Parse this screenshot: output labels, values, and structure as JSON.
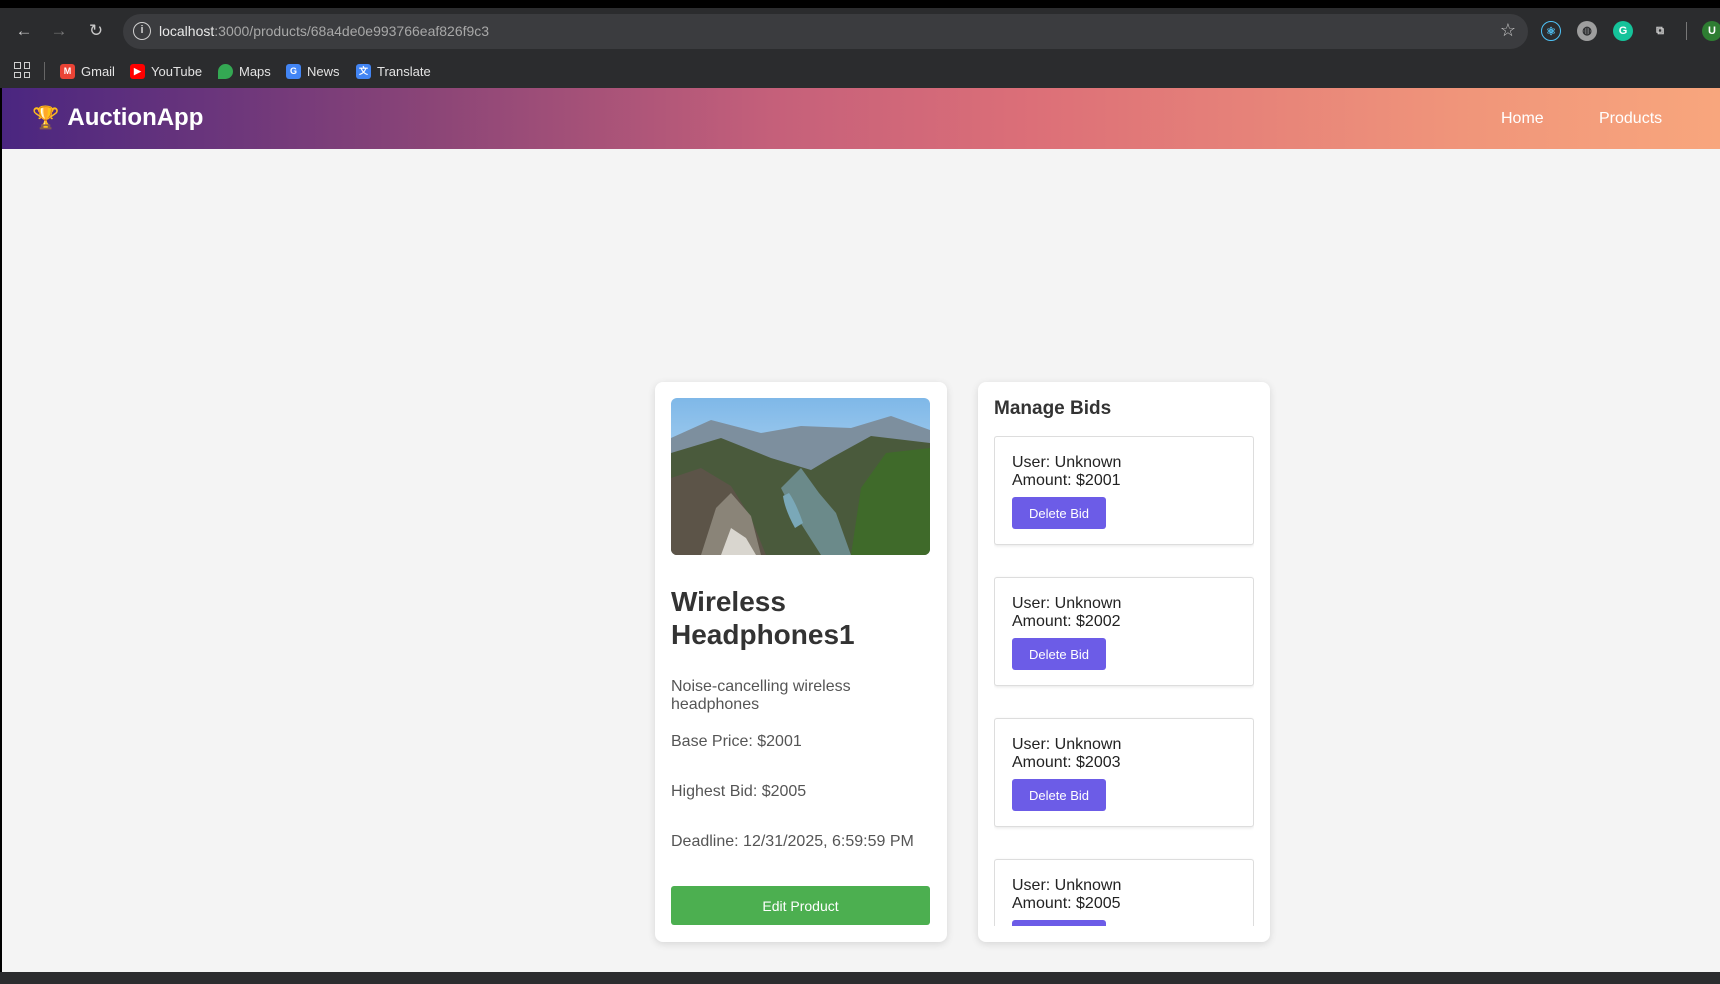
{
  "browser": {
    "url_host": "localhost",
    "url_path": ":3000/products/68a4de0e993766eaf826f9c3",
    "ext_avatar": "U",
    "bookmarks": [
      {
        "label": "Gmail",
        "icon": "gmail-icon",
        "color": "#ea4335"
      },
      {
        "label": "YouTube",
        "icon": "youtube-icon",
        "color": "#ff0000"
      },
      {
        "label": "Maps",
        "icon": "maps-icon",
        "color": "#34a853"
      },
      {
        "label": "News",
        "icon": "news-icon",
        "color": "#4285f4"
      },
      {
        "label": "Translate",
        "icon": "translate-icon",
        "color": "#4285f4"
      }
    ]
  },
  "navbar": {
    "brand": "AuctionApp",
    "links": [
      "Home",
      "Products"
    ]
  },
  "product": {
    "title": "Wireless Headphones1",
    "description": "Noise-cancelling wireless headphones",
    "base_price": "Base Price: $2001",
    "highest_bid": "Highest Bid: $2005",
    "deadline": "Deadline: 12/31/2025, 6:59:59 PM",
    "edit_label": "Edit Product"
  },
  "bids": {
    "title": "Manage Bids",
    "delete_label": "Delete Bid",
    "items": [
      {
        "user": "User: Unknown",
        "amount": "Amount: $2001"
      },
      {
        "user": "User: Unknown",
        "amount": "Amount: $2002"
      },
      {
        "user": "User: Unknown",
        "amount": "Amount: $2003"
      },
      {
        "user": "User: Unknown",
        "amount": "Amount: $2005"
      }
    ]
  },
  "colors": {
    "accent_green": "#4caf50",
    "accent_purple": "#6c5ce7"
  }
}
